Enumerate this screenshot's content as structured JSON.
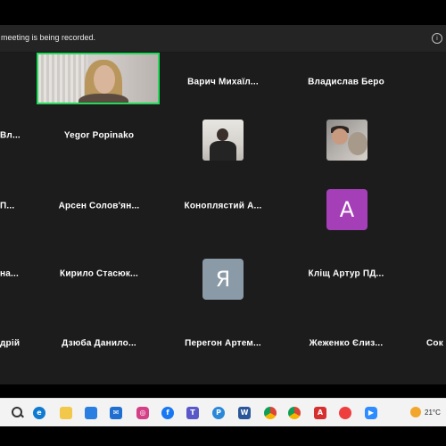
{
  "recording_banner": {
    "message": "meeting is being recorded.",
    "info_icon": "info-icon"
  },
  "participants": [
    {
      "name": "",
      "type": "video"
    },
    {
      "name": "Варич  Михаїл...",
      "type": "name"
    },
    {
      "name": "Владислав Беро",
      "type": "name"
    },
    {
      "name": "Вл...",
      "type": "name"
    },
    {
      "name": "Yegor Popinako",
      "type": "name"
    },
    {
      "name": "",
      "type": "photo"
    },
    {
      "name": "",
      "type": "photo"
    },
    {
      "name": "П...",
      "type": "name"
    },
    {
      "name": "Арсен  Солов'ян...",
      "type": "name"
    },
    {
      "name": "Коноплястий  А...",
      "type": "name"
    },
    {
      "name": "",
      "type": "avatar",
      "letter": "A",
      "color": "#a53fb8"
    },
    {
      "name": "на...",
      "type": "name"
    },
    {
      "name": "Кирило  Стасюк...",
      "type": "name"
    },
    {
      "name": "",
      "type": "avatar",
      "letter": "Я",
      "color": "#8a9aa6"
    },
    {
      "name": "Кліщ  Артур  ПД...",
      "type": "name"
    },
    {
      "name": "дрій",
      "type": "name"
    },
    {
      "name": "Дзюба  Данило...",
      "type": "name"
    },
    {
      "name": "Перегон  Артем...",
      "type": "name"
    },
    {
      "name": "Жеженко  Єлиз...",
      "type": "name"
    },
    {
      "name": "Сок",
      "type": "name"
    }
  ],
  "taskbar": {
    "icons": [
      "search-icon",
      "task-view-icon",
      "edge-icon",
      "file-explorer-icon",
      "store-icon",
      "mail-icon",
      "outlook-icon",
      "instagram-icon",
      "facebook-icon",
      "teams-icon",
      "pinterest-icon",
      "word-icon",
      "chrome-icon",
      "chrome-icon",
      "acrobat-icon",
      "app-icon",
      "zoom-icon"
    ],
    "weather_temp": "21°C"
  }
}
